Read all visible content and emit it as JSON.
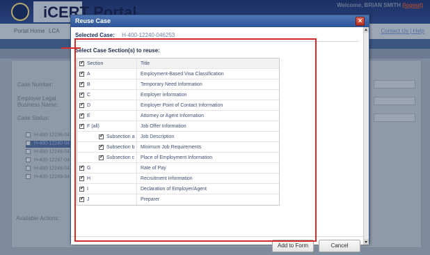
{
  "portal": {
    "title": "iCERT Portal",
    "welcome_prefix": "Welcome, BRIAN SMITH",
    "logout": "(logout)",
    "nav": [
      "Portal Home",
      "LCA"
    ],
    "contact_links": "Contact Us | Help",
    "labels": [
      "Case Number:",
      "Employer Legal Business Name:",
      "Case Status:",
      "Available Actions:"
    ],
    "rows": [
      "H-400-12236-04",
      "H-400-12240-04",
      "H-400-12246-04",
      "H-400-12247-04",
      "H-400-12248-04",
      "H-400-12249-04"
    ]
  },
  "dialog": {
    "title": "Reuse Case",
    "close_symbol": "×",
    "selected_case_label": "Selected Case:",
    "selected_case_value": "H-400-12240-046253",
    "select_heading": "Select Case Section(s) to reuse:",
    "table": {
      "header": {
        "section": "Section",
        "title": "Title"
      },
      "rows": [
        {
          "section": "A",
          "title": "Employment-Based Visa Classification",
          "sub": false
        },
        {
          "section": "B",
          "title": "Temporary Need Information",
          "sub": false
        },
        {
          "section": "C",
          "title": "Employer Information",
          "sub": false
        },
        {
          "section": "D",
          "title": "Employer Point of Contact Information",
          "sub": false
        },
        {
          "section": "E",
          "title": "Attorney or Agent Information",
          "sub": false
        },
        {
          "section": "F (all)",
          "title": "Job Offer Information",
          "sub": false
        },
        {
          "section": "Subsection a",
          "title": "Job Description",
          "sub": true
        },
        {
          "section": "Subsection b",
          "title": "Minimum Job Requirements",
          "sub": true
        },
        {
          "section": "Subsection c",
          "title": "Place of Employment Information",
          "sub": true
        },
        {
          "section": "G",
          "title": "Rate of Pay",
          "sub": false
        },
        {
          "section": "H",
          "title": "Recruitment Information",
          "sub": false
        },
        {
          "section": "I",
          "title": "Declaration of Employer/Agent",
          "sub": false
        },
        {
          "section": "J",
          "title": "Preparer",
          "sub": false
        }
      ]
    },
    "buttons": {
      "add": "Add to Form",
      "cancel": "Cancel"
    }
  },
  "colors": {
    "annotation": "#d42a2a",
    "titlebar": "#2c5396",
    "text_link": "#3b4f75"
  }
}
